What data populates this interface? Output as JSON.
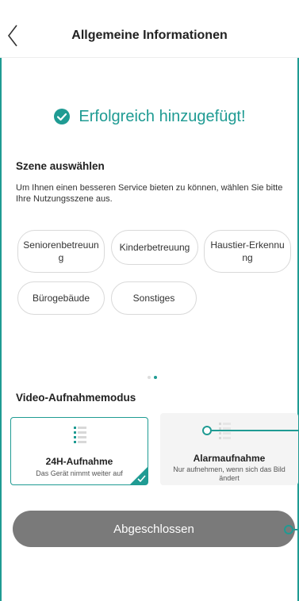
{
  "header": {
    "title": "Allgemeine Informationen",
    "back_icon": "chevron-left-icon"
  },
  "status": {
    "message": "Erfolgreich hinzugefügt!",
    "icon": "check-circle-icon",
    "color": "#1f9b93"
  },
  "scene": {
    "title": "Szene auswählen",
    "description": "Um Ihnen einen besseren Service bieten zu können, wählen Sie bitte Ihre Nutzungsszene aus.",
    "options": [
      "Seniorenbetreuung",
      "Kinderbetreuung",
      "Haustier-Erkennung",
      "Bürogebäude",
      "Sonstiges"
    ],
    "options_wrapped": [
      "Seniorenbetreuun g",
      "Kinderbetreuung",
      "Haustier-Erkennu ng",
      "Bürogebäude",
      "Sonstiges"
    ]
  },
  "pager": {
    "pages": 2,
    "active_index": 1
  },
  "recording": {
    "title": "Video-Aufnahmemodus",
    "modes": [
      {
        "label": "24H-Aufnahme",
        "sub": "Das Gerät nimmt weiter auf",
        "selected": true
      },
      {
        "label": "Alarmaufnahme",
        "sub": "Nur aufnehmen, wenn sich das Bild ändert",
        "selected": false
      }
    ]
  },
  "actions": {
    "finish_label": "Abgeschlossen"
  },
  "colors": {
    "accent": "#1f9b93",
    "button": "#7a7a7a",
    "card_bg": "#f4f4f4"
  }
}
